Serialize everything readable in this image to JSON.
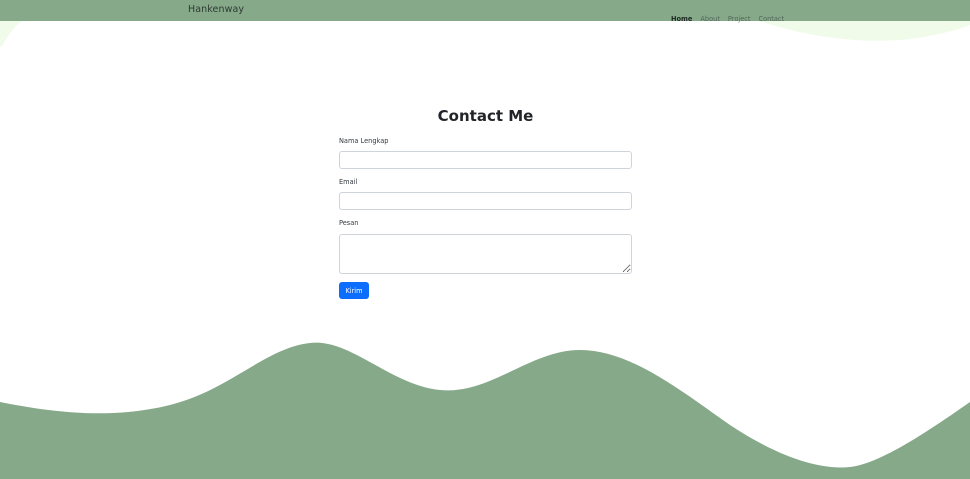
{
  "navbar": {
    "brand": "Hankenway",
    "links": [
      {
        "label": "Home",
        "active": true
      },
      {
        "label": "About",
        "active": false
      },
      {
        "label": "Project",
        "active": false
      },
      {
        "label": "Contact",
        "active": false
      }
    ]
  },
  "contact": {
    "title": "Contact Me",
    "fields": {
      "name": {
        "label": "Nama Lengkap",
        "value": "",
        "placeholder": ""
      },
      "email": {
        "label": "Email",
        "value": "",
        "placeholder": ""
      },
      "message": {
        "label": "Pesan",
        "value": "",
        "placeholder": ""
      }
    },
    "submit_label": "Kirim"
  },
  "colors": {
    "nav_background": "#86a98a",
    "wave_green": "#86a98a",
    "light_wave": "#f0fbea",
    "button_blue": "#0d6efd"
  }
}
